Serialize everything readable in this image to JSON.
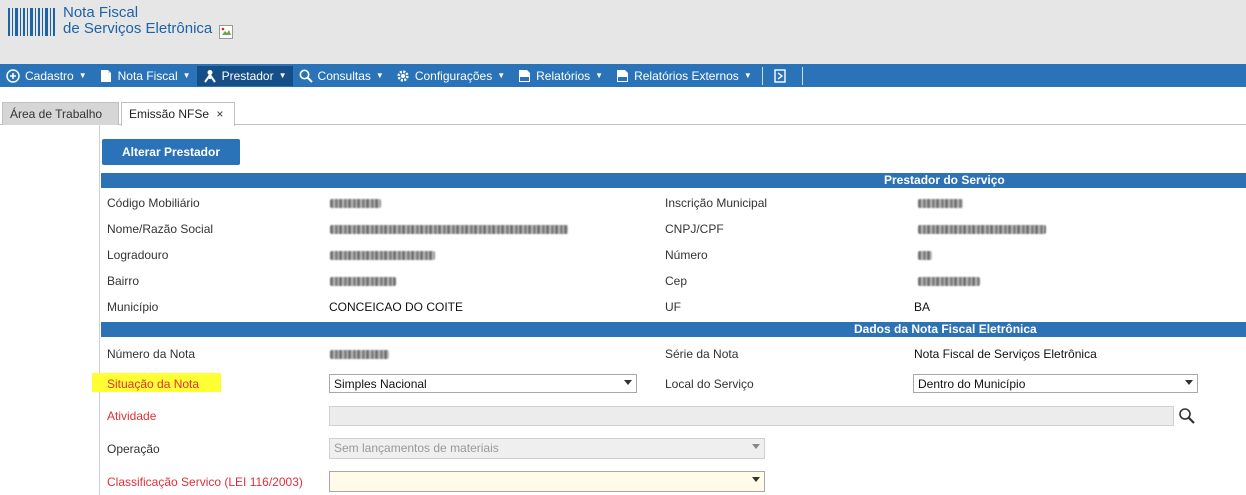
{
  "header": {
    "title_line1": "Nota Fiscal",
    "title_line2": "de Serviços Eletrônica"
  },
  "menu": [
    {
      "label": "Cadastro",
      "icon": "plus-circle-icon"
    },
    {
      "label": "Nota Fiscal",
      "icon": "document-icon"
    },
    {
      "label": "Prestador",
      "icon": "person-icon"
    },
    {
      "label": "Consultas",
      "icon": "search-icon"
    },
    {
      "label": "Configurações",
      "icon": "gear-icon"
    },
    {
      "label": "Relatórios",
      "icon": "pdf-report-icon"
    },
    {
      "label": "Relatórios Externos",
      "icon": "pdf-report-icon"
    }
  ],
  "tabs": {
    "workspace": "Área de Trabalho",
    "emissao": "Emissão NFSe",
    "close": "×"
  },
  "buttons": {
    "alterar_prestador": "Alterar Prestador"
  },
  "prestador": {
    "section_title": "Prestador do Serviço",
    "codigo_mobiliario_label": "Código Mobiliário",
    "inscricao_municipal_label": "Inscrição Municipal",
    "nome_label": "Nome/Razão Social",
    "cnpj_label": "CNPJ/CPF",
    "logradouro_label": "Logradouro",
    "numero_label": "Número",
    "bairro_label": "Bairro",
    "cep_label": "Cep",
    "municipio_label": "Município",
    "municipio_value": "CONCEICAO DO COITE",
    "uf_label": "UF",
    "uf_value": "BA"
  },
  "nota": {
    "section_title": "Dados da Nota Fiscal Eletrônica",
    "numero_label": "Número da Nota",
    "serie_label": "Série da Nota",
    "serie_value": "Nota Fiscal de Serviços Eletrônica",
    "situacao_label": "Situação da Nota",
    "situacao_value": "Simples Nacional",
    "local_label": "Local do Serviço",
    "local_value": "Dentro do Município",
    "atividade_label": "Atividade",
    "operacao_label": "Operação",
    "operacao_value": "Sem lançamentos de materiais",
    "classificacao_label": "Classificação Servico (LEI 116/2003)",
    "classificacao_value": ""
  },
  "colors": {
    "menubar": "#2a73b8",
    "section_bar": "#2c72b4",
    "required_label": "#e0303a",
    "highlight": "#ffff33"
  }
}
